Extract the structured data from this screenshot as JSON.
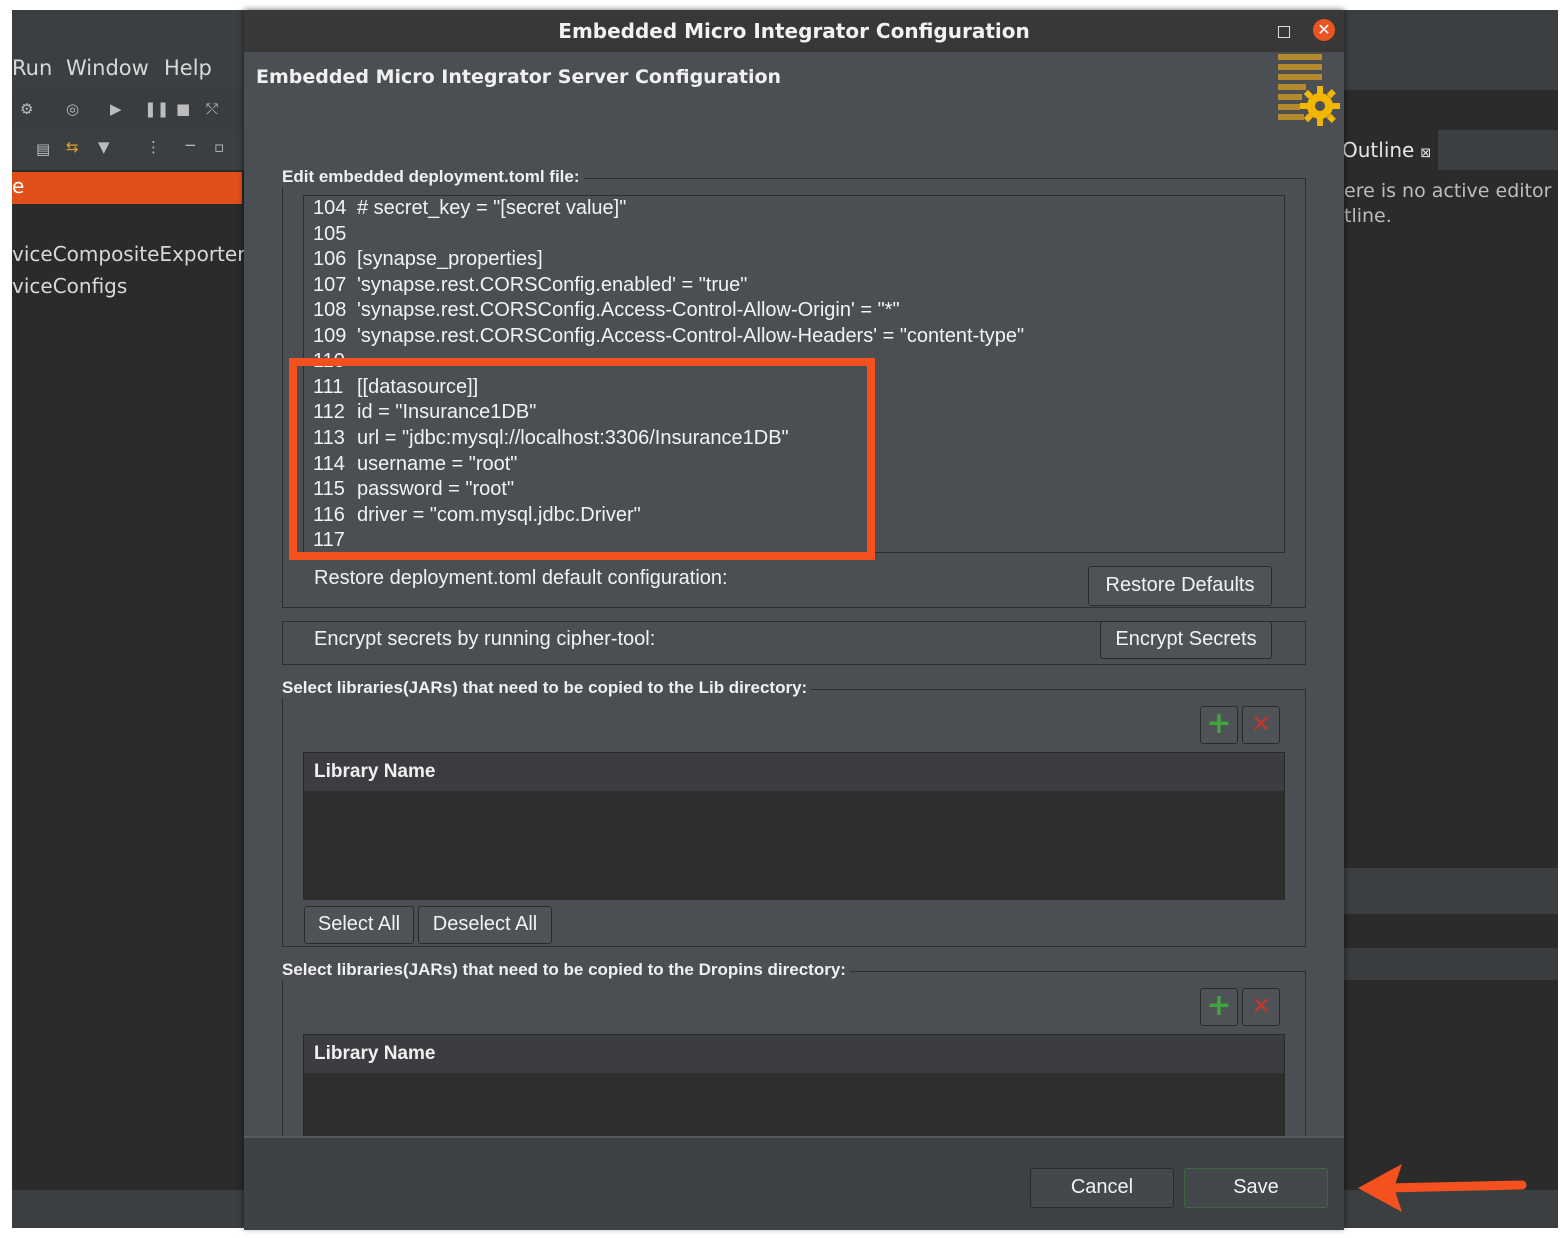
{
  "ide": {
    "menu": [
      "Run",
      "Window",
      "Help"
    ],
    "left_items": [
      "e",
      "viceCompositeExporter",
      "viceConfigs"
    ],
    "outline_tab": "Outline",
    "outline_message_1": "ere is no active editor",
    "outline_message_2": "tline."
  },
  "dialog": {
    "title": "Embedded Micro Integrator Configuration",
    "banner_title": "Embedded Micro Integrator Server Configuration",
    "banner_icon": "gear-document-icon",
    "edit_group_label": "Edit embedded deployment.toml file:",
    "code_lines": [
      {
        "n": "104",
        "t": "# secret_key = \"[secret value]\""
      },
      {
        "n": "105",
        "t": ""
      },
      {
        "n": "106",
        "t": "[synapse_properties]"
      },
      {
        "n": "107",
        "t": "'synapse.rest.CORSConfig.enabled' = \"true\""
      },
      {
        "n": "108",
        "t": "'synapse.rest.CORSConfig.Access-Control-Allow-Origin' = \"*\""
      },
      {
        "n": "109",
        "t": "'synapse.rest.CORSConfig.Access-Control-Allow-Headers' = \"content-type\""
      },
      {
        "n": "110",
        "t": ""
      },
      {
        "n": "111",
        "t": "[[datasource]]"
      },
      {
        "n": "112",
        "t": "id = \"Insurance1DB\""
      },
      {
        "n": "113",
        "t": "url = \"jdbc:mysql://localhost:3306/Insurance1DB\""
      },
      {
        "n": "114",
        "t": "username = \"root\""
      },
      {
        "n": "115",
        "t": "password = \"root\""
      },
      {
        "n": "116",
        "t": "driver = \"com.mysql.jdbc.Driver\""
      },
      {
        "n": "117",
        "t": ""
      }
    ],
    "restore_label": "Restore deployment.toml default configuration:",
    "restore_button": "Restore Defaults",
    "encrypt_label": "Encrypt secrets by running cipher-tool:",
    "encrypt_button": "Encrypt Secrets",
    "lib_group_label": "Select libraries(JARs) that need to be copied to the Lib directory:",
    "lib_table_header": "Library Name",
    "select_all": "Select All",
    "deselect_all": "Deselect All",
    "dropins_group_label": "Select libraries(JARs) that need to be copied to the Dropins directory:",
    "dropins_table_header": "Library Name",
    "add_icon": "+",
    "remove_icon": "✕",
    "cancel_button": "Cancel",
    "save_button": "Save"
  },
  "colors": {
    "highlight": "#f4511e",
    "add": "#3fa33f",
    "remove": "#c0392b"
  }
}
